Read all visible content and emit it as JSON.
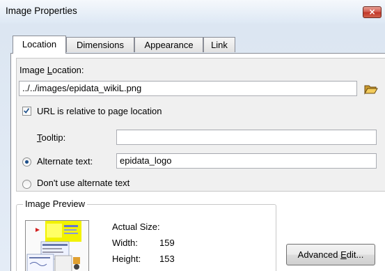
{
  "dialog": {
    "title": "Image Properties",
    "close_label": "×"
  },
  "tabs": [
    {
      "label": "Location",
      "active": true
    },
    {
      "label": "Dimensions",
      "active": false
    },
    {
      "label": "Appearance",
      "active": false
    },
    {
      "label": "Link",
      "active": false
    }
  ],
  "location": {
    "image_location_prefix": "Image ",
    "image_location_accel": "L",
    "image_location_suffix": "ocation:",
    "image_location_value": "../../images/epidata_wikiL.png",
    "relative_checkbox_label": "URL is relative to page location",
    "relative_checked": true,
    "tooltip_accel": "T",
    "tooltip_suffix": "ooltip:",
    "tooltip_value": "",
    "alternate_text_label": "Alternate text:",
    "alternate_text_value": "epidata_logo",
    "alternate_text_selected": true,
    "no_alternate_label": "Don't use alternate text",
    "browse_icon": "folder-open-icon"
  },
  "preview": {
    "legend": "Image Preview",
    "actual_size_label": "Actual Size:",
    "width_label": "Width:",
    "width_value": "159",
    "height_label": "Height:",
    "height_value": "153"
  },
  "advanced": {
    "label_prefix": "Advanced ",
    "label_accel": "E",
    "label_suffix": "dit..."
  },
  "colors": {
    "accent": "#1c4f8a",
    "close_red": "#c13526",
    "title_bg": "#dce6f2"
  }
}
